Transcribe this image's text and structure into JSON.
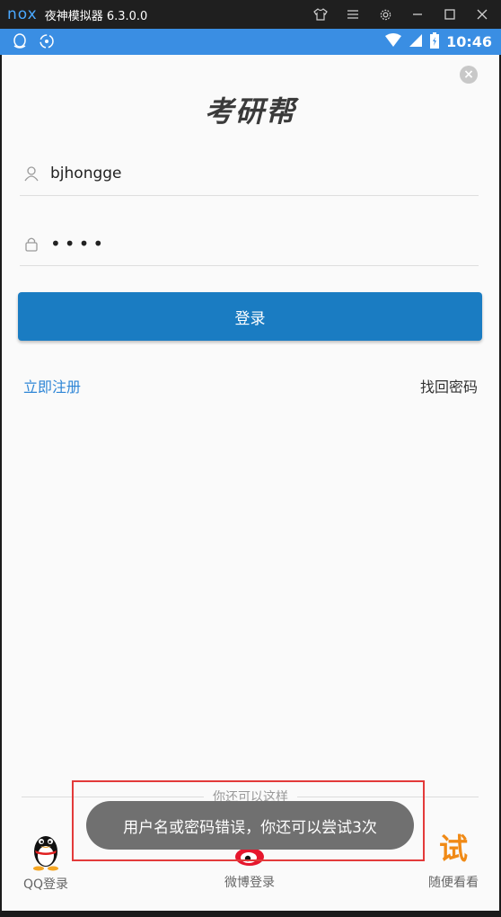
{
  "emulator": {
    "logo": "nox",
    "title": "夜神模拟器 6.3.0.0",
    "controls": [
      "shirt-icon",
      "menu-icon",
      "gear-icon",
      "minimize-icon",
      "maximize-icon",
      "close-icon"
    ]
  },
  "status_bar": {
    "time": "10:46",
    "left_icons": [
      "qq-notification-icon",
      "sync-icon"
    ],
    "right_icons": [
      "wifi-icon",
      "signal-icon",
      "battery-icon"
    ]
  },
  "login": {
    "app_title": "考研帮",
    "username": "bjhongge",
    "password_mask": "••••",
    "login_button": "登录",
    "register_link": "立即注册",
    "forgot_link": "找回密码"
  },
  "alternatives": {
    "heading": "你还可以这样",
    "items": [
      {
        "label": "QQ登录",
        "icon": "qq-icon"
      },
      {
        "label": "微博登录",
        "icon": "weibo-icon"
      },
      {
        "label": "随便看看",
        "icon": "try-icon",
        "glyph": "试"
      }
    ]
  },
  "toast": {
    "message": "用户名或密码错误，你还可以尝试3次"
  },
  "colors": {
    "status_bar": "#3a8ee3",
    "login_button": "#1a7cc2",
    "register_link": "#2f86d6",
    "toast_bg": "#707070",
    "highlight": "#e33a3a",
    "try_accent": "#f08a16"
  }
}
